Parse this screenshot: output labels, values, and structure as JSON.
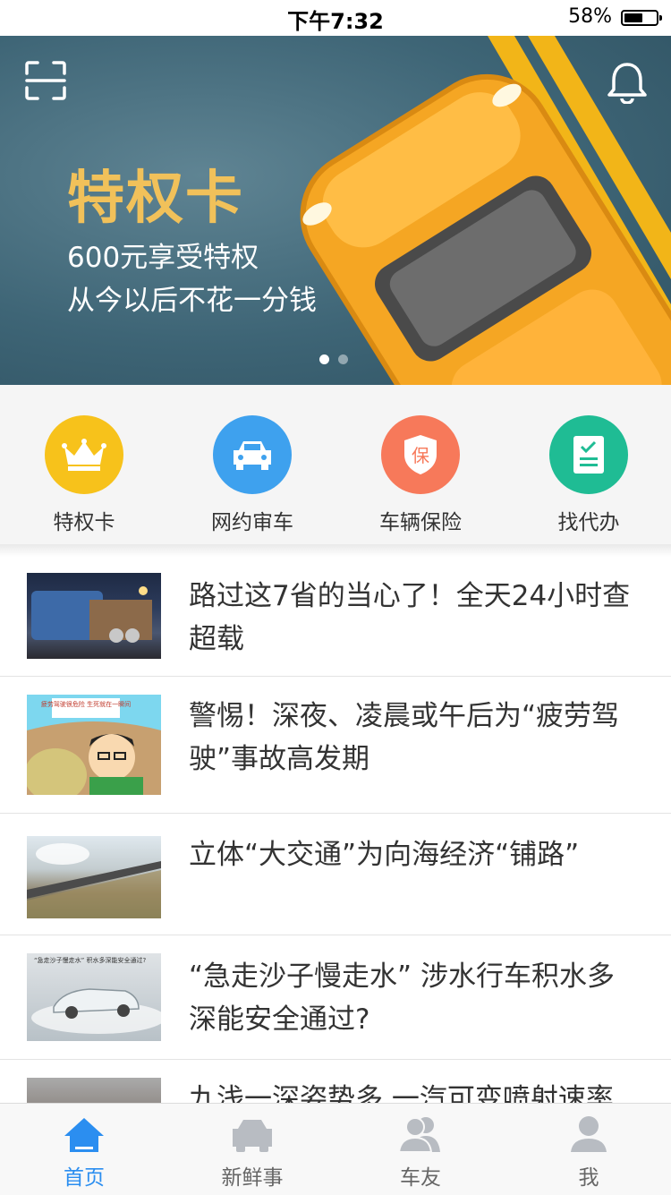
{
  "status_bar": {
    "time": "下午7:32",
    "battery_percent": "58%",
    "battery_level": 0.58
  },
  "banner": {
    "title": "特权卡",
    "subtitle_line1": "600元享受特权",
    "subtitle_line2": "从今以后不花一分钱",
    "slide_count": 2,
    "active_slide": 0,
    "scan_icon": "scan-icon",
    "bell_icon": "bell-icon"
  },
  "quick_actions": [
    {
      "label": "特权卡",
      "icon": "crown-icon",
      "color": "#f7c21b"
    },
    {
      "label": "网约审车",
      "icon": "car-icon",
      "color": "#3ea1ee"
    },
    {
      "label": "车辆保险",
      "icon": "shield-icon",
      "color": "#f7795a",
      "glyph": "保"
    },
    {
      "label": "找代办",
      "icon": "document-icon",
      "color": "#1fbc94"
    }
  ],
  "news": [
    {
      "title": "路过这7省的当心了！全天24小时查超载"
    },
    {
      "title": "警惕！深夜、凌晨或午后为“疲劳驾驶”事故高发期",
      "image_caption": "疲劳驾驶很危险 生死就在一瞬间"
    },
    {
      "title": "立体“大交通”为向海经济“铺路”"
    },
    {
      "title": "“急走沙子慢走水” 涉水行车积水多深能安全通过?",
      "image_caption": "“急走沙子慢走水” 积水多深能安全通过?"
    },
    {
      "title": "九浅一深姿势多 一汽可变喷射速率"
    }
  ],
  "tabs": [
    {
      "label": "首页",
      "icon": "home-icon",
      "active": true
    },
    {
      "label": "新鲜事",
      "icon": "car-front-icon",
      "active": false
    },
    {
      "label": "车友",
      "icon": "friends-icon",
      "active": false
    },
    {
      "label": "我",
      "icon": "user-icon",
      "active": false
    }
  ],
  "colors": {
    "accent": "#2b8ef0",
    "banner_title": "#f1c15a"
  }
}
